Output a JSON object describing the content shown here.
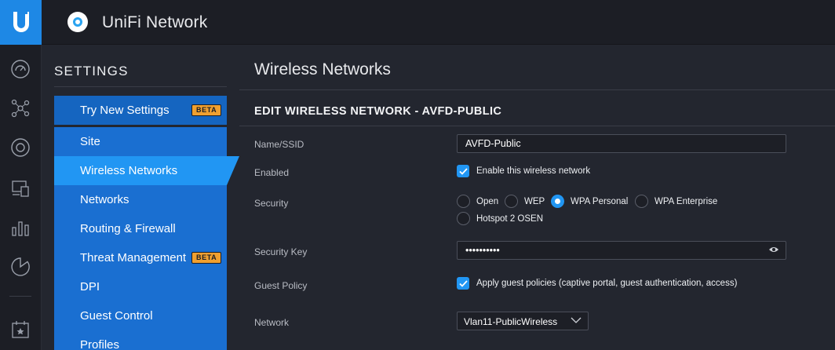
{
  "app": {
    "brand": "UniFi Network",
    "logo_letter": "U"
  },
  "rail": {
    "icons": [
      "dashboard-icon",
      "topology-icon",
      "devices-icon",
      "clients-icon",
      "statistics-icon",
      "insights-icon",
      "events-icon"
    ]
  },
  "settings": {
    "title": "SETTINGS",
    "try_new": {
      "label": "Try New Settings",
      "badge": "BETA"
    },
    "menu": [
      {
        "label": "Site"
      },
      {
        "label": "Wireless Networks"
      },
      {
        "label": "Networks"
      },
      {
        "label": "Routing & Firewall"
      },
      {
        "label": "Threat Management",
        "badge": "BETA"
      },
      {
        "label": "DPI"
      },
      {
        "label": "Guest Control"
      },
      {
        "label": "Profiles"
      }
    ],
    "active_index": 1
  },
  "main": {
    "page_title": "Wireless Networks",
    "section_title": "EDIT WIRELESS NETWORK - AVFD-PUBLIC",
    "fields": {
      "ssid": {
        "label": "Name/SSID",
        "value": "AVFD-Public"
      },
      "enabled": {
        "label": "Enabled",
        "checkbox_label": "Enable this wireless network",
        "checked": true
      },
      "security": {
        "label": "Security",
        "options": [
          "Open",
          "WEP",
          "WPA Personal",
          "WPA Enterprise",
          "Hotspot 2 OSEN"
        ],
        "selected": "WPA Personal"
      },
      "security_key": {
        "label": "Security Key",
        "value": "••••••••••"
      },
      "guest_policy": {
        "label": "Guest Policy",
        "checkbox_label": "Apply guest policies (captive portal, guest authentication, access)",
        "checked": true
      },
      "network": {
        "label": "Network",
        "value": "Vlan11-PublicWireless"
      }
    }
  },
  "colors": {
    "accent": "#2196f3",
    "menu_bg": "#1a6fd1",
    "beta": "#f0a030",
    "bg": "#23262f"
  }
}
